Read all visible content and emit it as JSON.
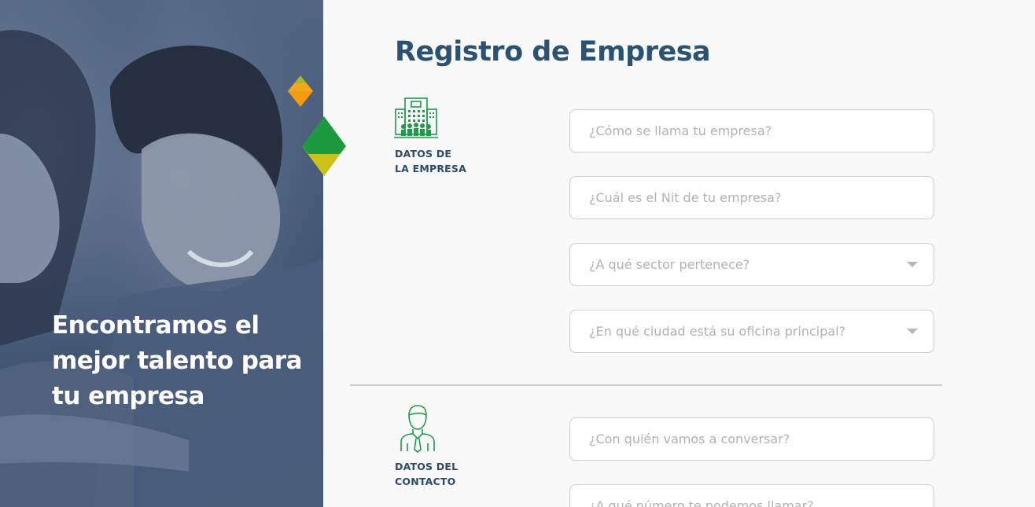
{
  "hero": {
    "tagline": "Encontramos el mejor talento para tu empresa"
  },
  "page": {
    "title": "Registro de Empresa"
  },
  "sections": {
    "company": {
      "label_line1": "DATOS DE",
      "label_line2": "LA EMPRESA",
      "icon": "building-icon"
    },
    "contact": {
      "label_line1": "DATOS DEL",
      "label_line2": "CONTACTO",
      "icon": "person-icon"
    }
  },
  "fields": {
    "company_name": {
      "placeholder": "¿Cómo se llama tu empresa?",
      "value": ""
    },
    "company_nit": {
      "placeholder": "¿Cuál es el Nit de tu empresa?",
      "value": ""
    },
    "sector": {
      "placeholder": "¿A qué sector pertenece?",
      "value": ""
    },
    "city": {
      "placeholder": "¿En qué ciudad está su oficina principal?",
      "value": ""
    },
    "contact_name": {
      "placeholder": "¿Con quién vamos a conversar?",
      "value": ""
    },
    "contact_phone": {
      "placeholder": "¿A qué número te podemos llamar?",
      "value": ""
    }
  },
  "colors": {
    "title": "#2b5173",
    "icon_green": "#1f9a4a",
    "diamond_orange": "#f39c12",
    "diamond_green": "#1b9a3f",
    "diamond_yellow": "#c8c21a"
  }
}
